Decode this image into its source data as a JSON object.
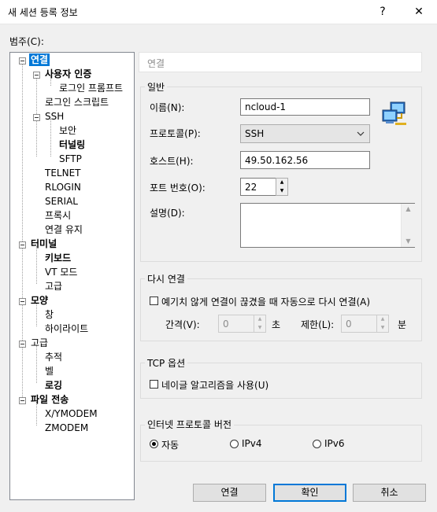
{
  "window": {
    "title": "새 세션 등록 정보",
    "help": "?",
    "close": "✕"
  },
  "category_label": "범주(C):",
  "tree": [
    {
      "label": "연결",
      "level": 0,
      "selected": true,
      "bold": true
    },
    {
      "label": "사용자 인증",
      "level": 1,
      "bold": true
    },
    {
      "label": "로그인 프롬프트",
      "level": 2,
      "bold": false
    },
    {
      "label": "로그인 스크립트",
      "level": 1,
      "bold": false
    },
    {
      "label": "SSH",
      "level": 1,
      "bold": false
    },
    {
      "label": "보안",
      "level": 2,
      "bold": false
    },
    {
      "label": "터널링",
      "level": 2,
      "bold": true
    },
    {
      "label": "SFTP",
      "level": 2,
      "bold": false
    },
    {
      "label": "TELNET",
      "level": 1,
      "bold": false
    },
    {
      "label": "RLOGIN",
      "level": 1,
      "bold": false
    },
    {
      "label": "SERIAL",
      "level": 1,
      "bold": false
    },
    {
      "label": "프록시",
      "level": 1,
      "bold": false
    },
    {
      "label": "연결 유지",
      "level": 1,
      "bold": false
    },
    {
      "label": "터미널",
      "level": 0,
      "bold": true
    },
    {
      "label": "키보드",
      "level": 1,
      "bold": true
    },
    {
      "label": "VT 모드",
      "level": 1,
      "bold": false
    },
    {
      "label": "고급",
      "level": 1,
      "bold": false
    },
    {
      "label": "모양",
      "level": 0,
      "bold": true
    },
    {
      "label": "창",
      "level": 1,
      "bold": false
    },
    {
      "label": "하이라이트",
      "level": 1,
      "bold": false
    },
    {
      "label": "고급",
      "level": 0,
      "bold": false
    },
    {
      "label": "추적",
      "level": 1,
      "bold": false
    },
    {
      "label": "벨",
      "level": 1,
      "bold": false
    },
    {
      "label": "로깅",
      "level": 1,
      "bold": true
    },
    {
      "label": "파일 전송",
      "level": 0,
      "bold": true
    },
    {
      "label": "X/YMODEM",
      "level": 1,
      "bold": false
    },
    {
      "label": "ZMODEM",
      "level": 1,
      "bold": false
    }
  ],
  "header": {
    "title": "연결"
  },
  "general": {
    "group_label": "일반",
    "name_label": "이름(N):",
    "name_value": "ncloud-1",
    "protocol_label": "프로토콜(P):",
    "protocol_value": "SSH",
    "host_label": "호스트(H):",
    "host_value": "49.50.162.56",
    "port_label": "포트 번호(O):",
    "port_value": "22",
    "desc_label": "설명(D):",
    "desc_value": ""
  },
  "reconnect": {
    "group_label": "다시 연결",
    "auto_label": "예기치 않게 연결이 끊겼을 때 자동으로 다시 연결(A)",
    "interval_label": "간격(V):",
    "interval_value": "0",
    "interval_unit": "초",
    "limit_label": "제한(L):",
    "limit_value": "0",
    "limit_unit": "분"
  },
  "tcp": {
    "group_label": "TCP 옵션",
    "nagle_label": "네이글 알고리즘을 사용(U)"
  },
  "ip_version": {
    "group_label": "인터넷 프로토콜 버전",
    "options": [
      "자동",
      "IPv4",
      "IPv6"
    ],
    "selected": "자동"
  },
  "buttons": {
    "connect": "연결",
    "ok": "확인",
    "cancel": "취소"
  }
}
